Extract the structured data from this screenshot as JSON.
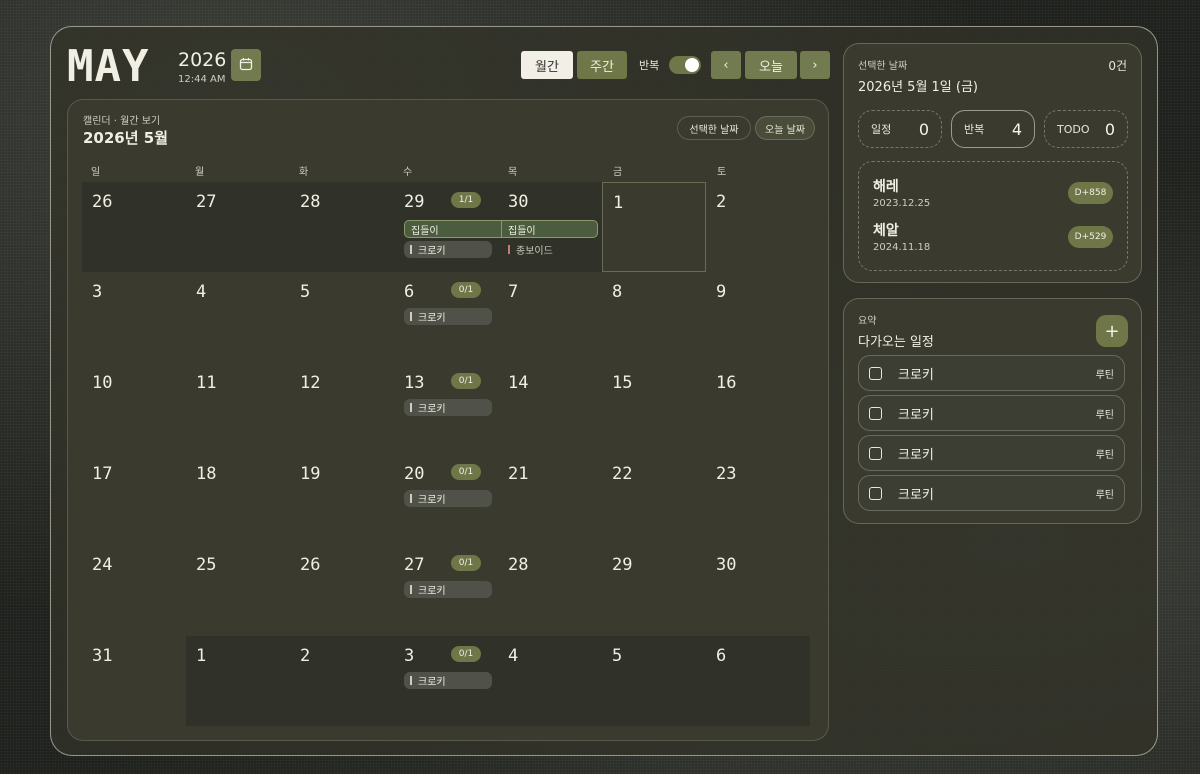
{
  "header": {
    "month": "MAY",
    "year": "2026",
    "time": "12:44 AM"
  },
  "view_tabs": {
    "month": "월간",
    "week": "주간"
  },
  "repeat_label": "반복",
  "nav": {
    "prev": "‹",
    "today": "오늘",
    "next": "›"
  },
  "calendar": {
    "subtitle": "캘린더 · 월간 보기",
    "title": "2026년 5월",
    "selected_btn": "선택한 날짜",
    "today_btn": "오늘 날짜",
    "weekdays": [
      "일",
      "월",
      "화",
      "수",
      "목",
      "금",
      "토"
    ],
    "weeks": [
      [
        "26",
        "27",
        "28",
        "29",
        "30",
        "1",
        "2"
      ],
      [
        "3",
        "4",
        "5",
        "6",
        "7",
        "8",
        "9"
      ],
      [
        "10",
        "11",
        "12",
        "13",
        "14",
        "15",
        "16"
      ],
      [
        "17",
        "18",
        "19",
        "20",
        "21",
        "22",
        "23"
      ],
      [
        "24",
        "25",
        "26",
        "27",
        "28",
        "29",
        "30"
      ],
      [
        "31",
        "1",
        "2",
        "3",
        "4",
        "5",
        "6"
      ]
    ],
    "badges": [
      "1/1",
      "0/1",
      "0/1",
      "0/1",
      "0/1",
      "0/1"
    ],
    "event_routine": "크로키",
    "event_span": "집들이",
    "event_other": "종보이드"
  },
  "selected": {
    "label": "선택한 날짜",
    "count": "0건",
    "date": "2026년 5월 1일 (금)",
    "stats": [
      {
        "label": "일정",
        "value": "0"
      },
      {
        "label": "반복",
        "value": "4"
      },
      {
        "label": "TODO",
        "value": "0"
      }
    ],
    "ddays": [
      {
        "name": "해레",
        "date": "2023.12.25",
        "dday": "D+858"
      },
      {
        "name": "체알",
        "date": "2024.11.18",
        "dday": "D+529"
      }
    ]
  },
  "upcoming": {
    "label": "요약",
    "title": "다가오는 일정",
    "add": "+",
    "items": [
      {
        "label": "크로키",
        "tag": "루틴"
      },
      {
        "label": "크로키",
        "tag": "루틴"
      },
      {
        "label": "크로키",
        "tag": "루틴"
      },
      {
        "label": "크로키",
        "tag": "루틴"
      }
    ]
  },
  "colors": {
    "accent": "#6f7648",
    "panel": "#3a3a2e",
    "text": "#f1efe4"
  }
}
